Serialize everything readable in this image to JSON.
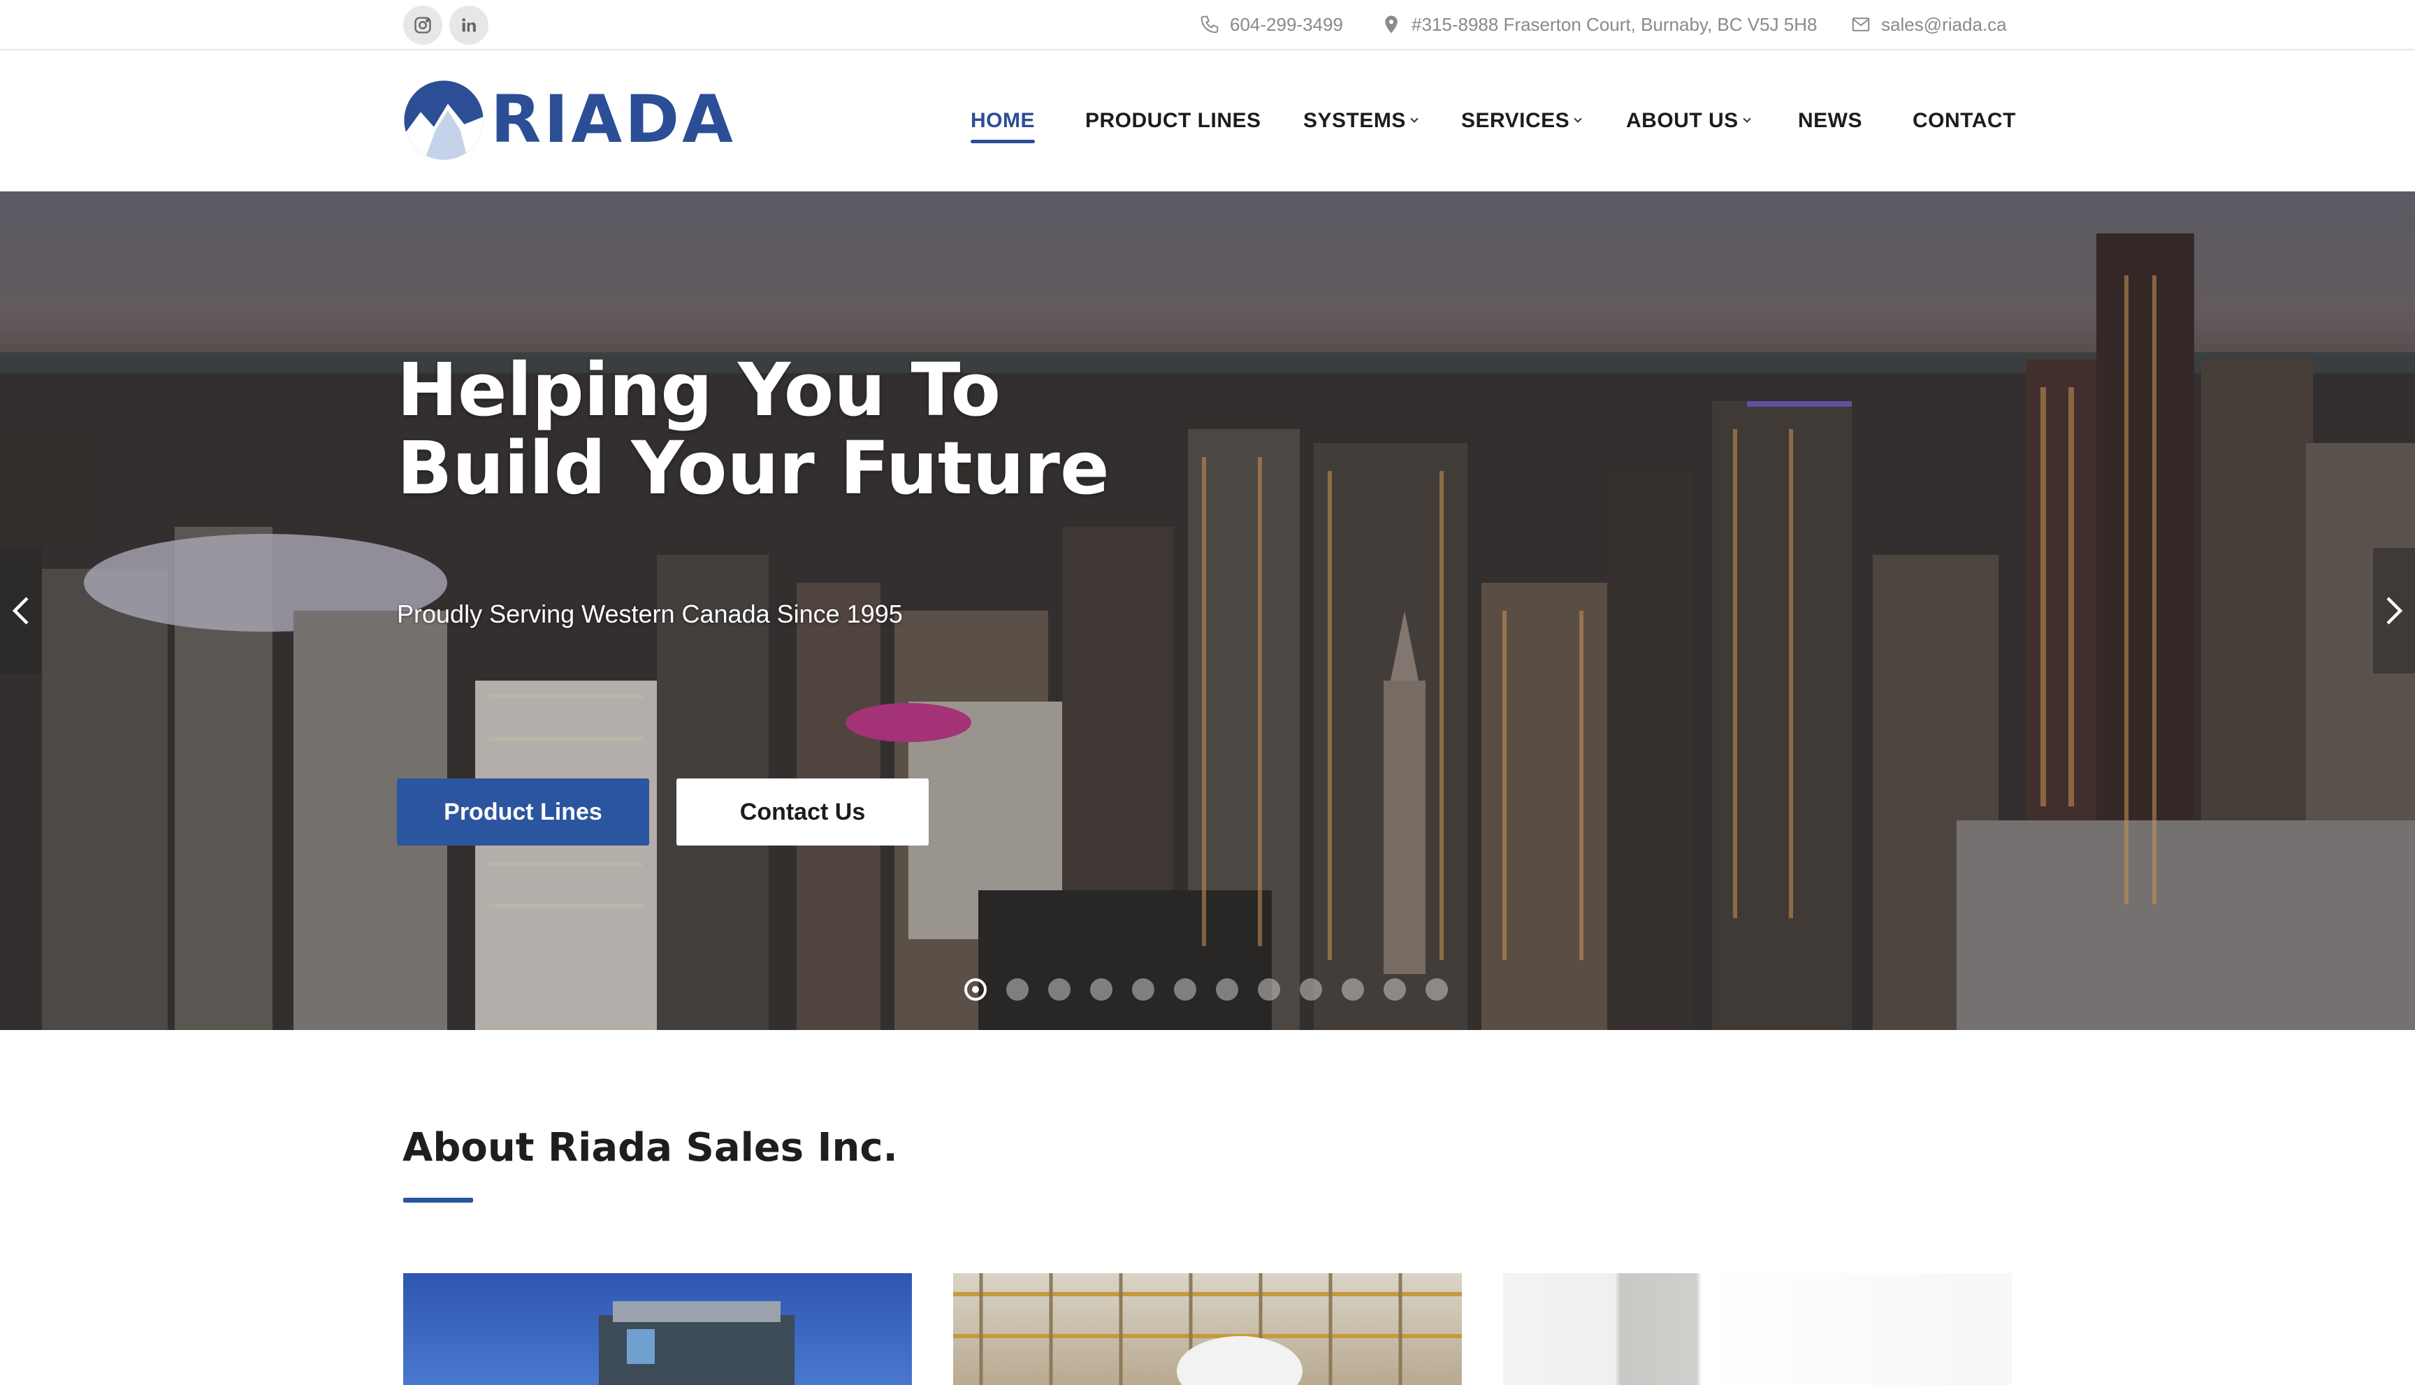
{
  "topbar": {
    "social": [
      {
        "name": "instagram",
        "icon": "instagram-icon"
      },
      {
        "name": "linkedin",
        "icon": "linkedin-icon"
      }
    ],
    "phone": "604-299-3499",
    "address": "#315-8988 Fraserton Court, Burnaby, BC V5J 5H8",
    "email": "sales@riada.ca"
  },
  "brand": {
    "name": "RIADA",
    "color": "#2b4e96"
  },
  "nav": {
    "home": "HOME",
    "product_lines": "PRODUCT LINES",
    "systems": "SYSTEMS",
    "services": "SERVICES",
    "about_us": "ABOUT US",
    "news": "NEWS",
    "contact": "CONTACT",
    "active": "HOME"
  },
  "hero": {
    "title_line1": "Helping You To",
    "title_line2": "Build Your Future",
    "subtitle": "Proudly Serving Western Canada Since 1995",
    "primary_button": "Product Lines",
    "secondary_button": "Contact Us",
    "slide_count": 12,
    "active_slide": 1
  },
  "about": {
    "title": "About Riada Sales Inc."
  },
  "colors": {
    "accent": "#2c559f",
    "text": "#1c1c1c",
    "muted": "#8a8a8a"
  }
}
